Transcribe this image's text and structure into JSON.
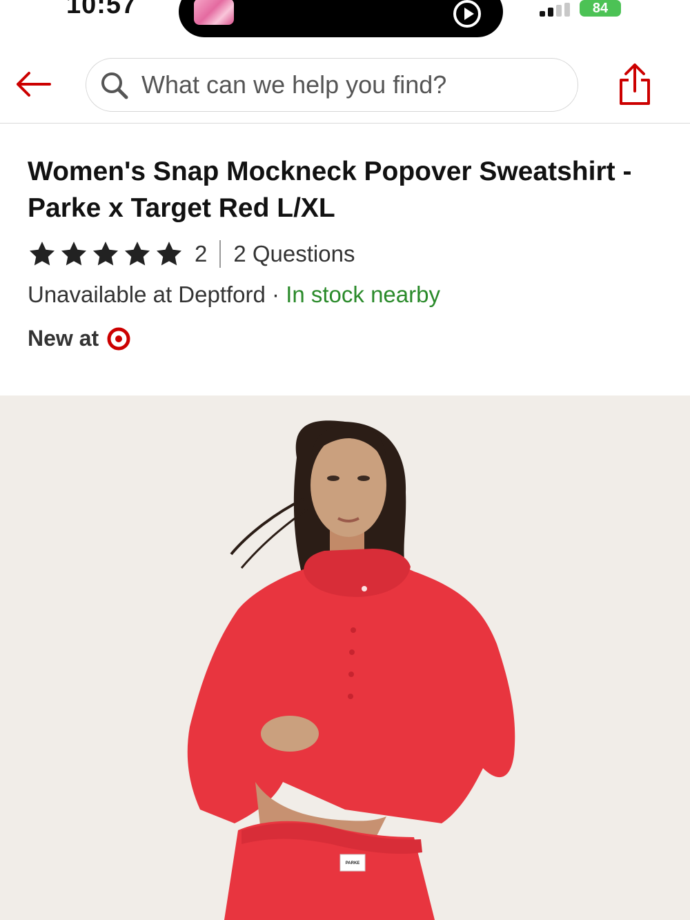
{
  "status_bar": {
    "time": "10:57",
    "battery": "84"
  },
  "search": {
    "placeholder": "What can we help you find?"
  },
  "product": {
    "title": "Women's Snap Mockneck Popover Sweatshirt - Parke x Target Red L/XL",
    "rating_stars": 5,
    "review_count": "2",
    "questions": "2 Questions",
    "availability": "Unavailable at Deptford",
    "availability_separator": " · ",
    "in_stock_text": "In stock nearby",
    "new_at": "New at",
    "waistband_tag": "PARKE"
  },
  "colors": {
    "accent": "#cc0000",
    "in_stock": "#2a8a2a",
    "sweatshirt": "#e8353f",
    "background_photo": "#f1ede8"
  },
  "icons": {
    "back": "arrow-left-icon",
    "search": "search-icon",
    "share": "share-icon",
    "star": "star-icon",
    "target": "target-logo-icon"
  }
}
